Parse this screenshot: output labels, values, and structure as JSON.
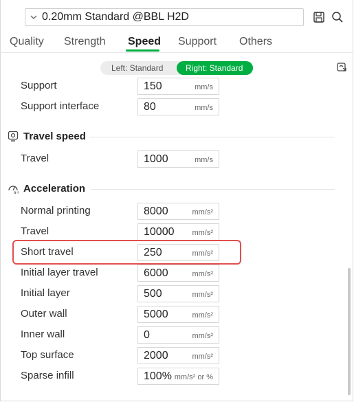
{
  "preset": {
    "name": "0.20mm Standard @BBL H2D"
  },
  "tabs": [
    {
      "label": "Quality"
    },
    {
      "label": "Strength"
    },
    {
      "label": "Speed"
    },
    {
      "label": "Support"
    },
    {
      "label": "Others"
    }
  ],
  "active_tab": "Speed",
  "toggle": {
    "left_label": "Left: Standard",
    "right_label": "Right: Standard",
    "selected": "right"
  },
  "rows_top": [
    {
      "label": "Support",
      "value": "150",
      "unit": "mm/s"
    },
    {
      "label": "Support interface",
      "value": "80",
      "unit": "mm/s"
    }
  ],
  "travel_speed": {
    "title": "Travel speed",
    "rows": [
      {
        "label": "Travel",
        "value": "1000",
        "unit": "mm/s"
      }
    ]
  },
  "acceleration": {
    "title": "Acceleration",
    "rows": [
      {
        "label": "Normal printing",
        "value": "8000",
        "unit": "mm/s²"
      },
      {
        "label": "Travel",
        "value": "10000",
        "unit": "mm/s²"
      },
      {
        "label": "Short travel",
        "value": "250",
        "unit": "mm/s²"
      },
      {
        "label": "Initial layer travel",
        "value": "6000",
        "unit": "mm/s²"
      },
      {
        "label": "Initial layer",
        "value": "500",
        "unit": "mm/s²"
      },
      {
        "label": "Outer wall",
        "value": "5000",
        "unit": "mm/s²"
      },
      {
        "label": "Inner wall",
        "value": "0",
        "unit": "mm/s²"
      },
      {
        "label": "Top surface",
        "value": "2000",
        "unit": "mm/s²"
      },
      {
        "label": "Sparse infill",
        "value": "100%",
        "unit": "mm/s² or %"
      }
    ]
  },
  "colors": {
    "accent": "#00ae42",
    "highlight": "#e05050"
  },
  "icons": [
    "chevron-down-icon",
    "save-icon",
    "search-icon",
    "sync-icon",
    "travel-speed-icon",
    "acceleration-icon"
  ]
}
